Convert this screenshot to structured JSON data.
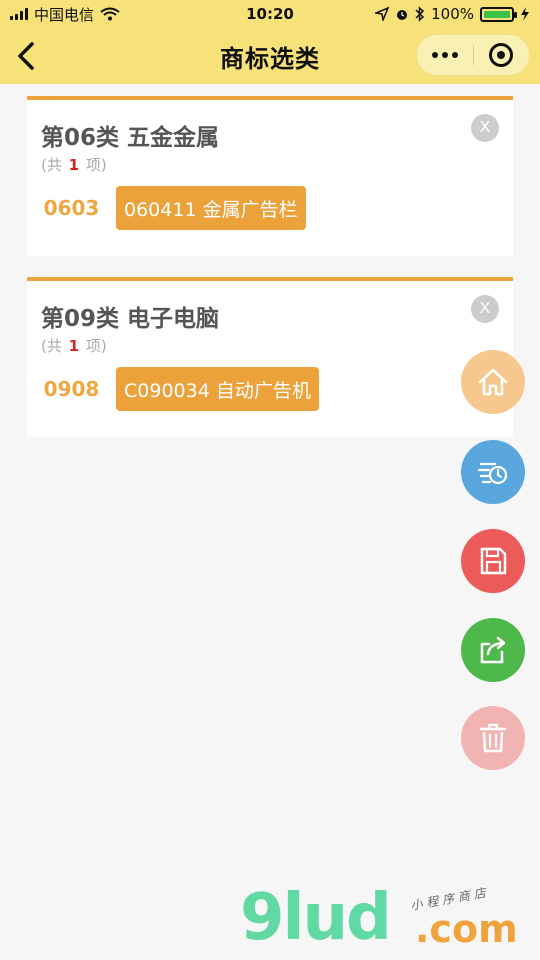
{
  "status_bar": {
    "carrier": "中国电信",
    "time": "10:20",
    "battery_percent": "100%",
    "battery_level": 1.0
  },
  "nav": {
    "title": "商标选类",
    "back_icon": "chevron-left-icon",
    "more_icon": "more-dots-icon",
    "close_icon": "target-circle-icon"
  },
  "cards": [
    {
      "title": "第06类  五金金属",
      "count_prefix": "(共",
      "count": "1",
      "count_suffix": "项)",
      "close_label": "X",
      "items": [
        {
          "group": "0603",
          "tag": "060411 金属广告栏"
        }
      ]
    },
    {
      "title": "第09类  电子电脑",
      "count_prefix": "(共",
      "count": "1",
      "count_suffix": "项)",
      "close_label": "X",
      "items": [
        {
          "group": "0908",
          "tag": "C090034 自动广告机"
        }
      ]
    }
  ],
  "fabs": [
    {
      "icon": "home-icon",
      "color": "#f6c88d"
    },
    {
      "icon": "history-icon",
      "color": "#5aa7de"
    },
    {
      "icon": "save-icon",
      "color": "#eb5b5a"
    },
    {
      "icon": "share-icon",
      "color": "#4fb84a"
    },
    {
      "icon": "trash-icon",
      "color": "#f2b4b2"
    }
  ],
  "watermark": {
    "brand": "9lud",
    "domain": ".com",
    "slogan": "小程序商店"
  },
  "colors": {
    "header_bg": "#f7e27a",
    "accent": "#eba23b",
    "page_bg": "#f6f6f6"
  }
}
